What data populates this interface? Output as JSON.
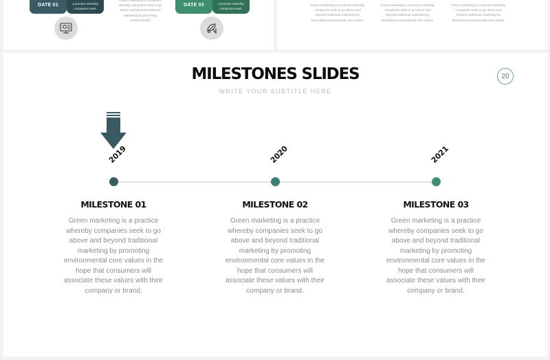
{
  "colors": {
    "dark_teal": "#3a5b64",
    "dark_teal_desc": "#2c4a50",
    "mid_teal": "#3c7d75",
    "green": "#3d8f6e",
    "green_desc": "#2f7256",
    "page_badge": "#6fa08f",
    "title": "#0d0d0d",
    "subtitle": "#b9b9b9",
    "body_text": "#8c8c8c"
  },
  "previous_slides": {
    "left": {
      "badges": [
        {
          "label": "DATE 01",
          "description": "a practice whereby companies seek.",
          "icon": "monitor-location-icon"
        },
        {
          "label": "DATE 03",
          "description": "a practice whereby companies seek.",
          "icon": "leaf-hand-icon"
        }
      ],
      "middle_text": "Green marketing is a practice whereby companies seek to go above and beyond traditional marketing by promoting environmental."
    },
    "right": {
      "texts": [
        "Green marketing is a practice whereby companies seek to go above and beyond traditional marketing by promoting environmental core values.",
        "Green marketing is a practice whereby companies seek to go above and beyond traditional marketing by promoting environmental core values.",
        "Green marketing is a practice whereby companies seek to go above and beyond traditional marketing by promoting environmental core values."
      ]
    }
  },
  "slide": {
    "title": "MILESTONES SLIDES",
    "subtitle": "WRITE YOUR SUBTITLE HERE",
    "page_number": "20",
    "current_marker": "2019",
    "milestones": [
      {
        "year": "2019",
        "title": "MILESTONE 01",
        "text": "Green marketing is a practice whereby companies seek to go above and beyond traditional marketing by promoting environmental core values in the hope that consumers will associate these values with their company or brand.",
        "dot_color": "#3a5b64"
      },
      {
        "year": "2020",
        "title": "MILESTONE 02",
        "text": "Green marketing is a practice whereby companies seek to go above and beyond traditional marketing by promoting environmental core values in the hope that consumers will associate these values with their company or brand.",
        "dot_color": "#3c7d75"
      },
      {
        "year": "2021",
        "title": "MILESTONE 03",
        "text": "Green marketing is a practice whereby companies seek to go above and beyond traditional marketing by promoting environmental core values in the hope that consumers will associate these values with their company or brand.",
        "dot_color": "#3d8f6e"
      }
    ]
  }
}
